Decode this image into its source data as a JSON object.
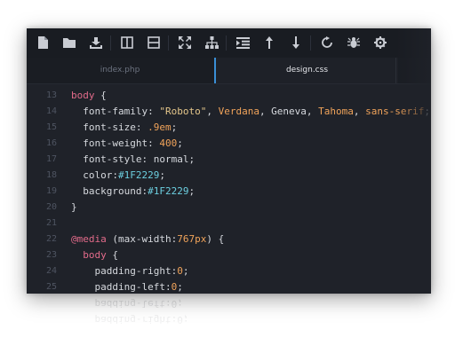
{
  "toolbar": {
    "icons": [
      "new-file-icon",
      "open-folder-icon",
      "download-icon",
      "split-vertical-icon",
      "split-horizontal-icon",
      "fullscreen-icon",
      "sitemap-icon",
      "indent-icon",
      "arrow-up-icon",
      "arrow-down-icon",
      "refresh-icon",
      "bug-icon",
      "settings-icon"
    ]
  },
  "tabs": [
    {
      "label": "index.php",
      "active": false
    },
    {
      "label": "design.css",
      "active": true
    }
  ],
  "editor": {
    "lines": [
      {
        "n": "13",
        "tokens": [
          {
            "t": "body",
            "c": "k"
          },
          {
            "t": " {",
            "c": "p"
          }
        ]
      },
      {
        "n": "14",
        "tokens": [
          {
            "t": "  font-family",
            "c": "p"
          },
          {
            "t": ": ",
            "c": "p"
          },
          {
            "t": "\"Roboto\"",
            "c": "s"
          },
          {
            "t": ", ",
            "c": "p"
          },
          {
            "t": "Verdana",
            "c": "n"
          },
          {
            "t": ", Geneva, ",
            "c": "p"
          },
          {
            "t": "Tahoma",
            "c": "n"
          },
          {
            "t": ", ",
            "c": "p"
          },
          {
            "t": "sans-serif",
            "c": "n"
          },
          {
            "t": ";",
            "c": "p"
          }
        ]
      },
      {
        "n": "15",
        "tokens": [
          {
            "t": "  font-size",
            "c": "p"
          },
          {
            "t": ": ",
            "c": "p"
          },
          {
            "t": ".9em",
            "c": "n"
          },
          {
            "t": ";",
            "c": "p"
          }
        ]
      },
      {
        "n": "16",
        "tokens": [
          {
            "t": "  font-weight",
            "c": "p"
          },
          {
            "t": ": ",
            "c": "p"
          },
          {
            "t": "400",
            "c": "n"
          },
          {
            "t": ";",
            "c": "p"
          }
        ]
      },
      {
        "n": "17",
        "tokens": [
          {
            "t": "  font-style",
            "c": "p"
          },
          {
            "t": ": normal;",
            "c": "p"
          }
        ]
      },
      {
        "n": "18",
        "tokens": [
          {
            "t": "  color",
            "c": "p"
          },
          {
            "t": ":",
            "c": "p"
          },
          {
            "t": "#1F2229",
            "c": "h"
          },
          {
            "t": ";",
            "c": "p"
          }
        ]
      },
      {
        "n": "19",
        "tokens": [
          {
            "t": "  background",
            "c": "p"
          },
          {
            "t": ":",
            "c": "p"
          },
          {
            "t": "#1F2229",
            "c": "h"
          },
          {
            "t": ";",
            "c": "p"
          }
        ]
      },
      {
        "n": "20",
        "tokens": [
          {
            "t": "}",
            "c": "p"
          }
        ]
      },
      {
        "n": "21",
        "tokens": []
      },
      {
        "n": "22",
        "tokens": [
          {
            "t": "@media",
            "c": "k"
          },
          {
            "t": " (max-width:",
            "c": "p"
          },
          {
            "t": "767px",
            "c": "n"
          },
          {
            "t": ") {",
            "c": "p"
          }
        ]
      },
      {
        "n": "23",
        "tokens": [
          {
            "t": "  body",
            "c": "k"
          },
          {
            "t": " {",
            "c": "p"
          }
        ]
      },
      {
        "n": "24",
        "tokens": [
          {
            "t": "    padding-right",
            "c": "p"
          },
          {
            "t": ":",
            "c": "p"
          },
          {
            "t": "0",
            "c": "n"
          },
          {
            "t": ";",
            "c": "p"
          }
        ]
      },
      {
        "n": "25",
        "tokens": [
          {
            "t": "    padding-left",
            "c": "p"
          },
          {
            "t": ":",
            "c": "p"
          },
          {
            "t": "0",
            "c": "n"
          },
          {
            "t": ";",
            "c": "p"
          }
        ]
      }
    ]
  },
  "reflection": {
    "lines": [
      "    padding-left:0;",
      "    padding-right:0;"
    ]
  },
  "colors": {
    "background": "#1F2229",
    "toolbar": "#191c22",
    "active_tab_accent": "#3a8fd6",
    "keyword": "#e26b8a",
    "string": "#e3c58a",
    "number": "#f0a35a",
    "hex": "#6ccfe0"
  }
}
